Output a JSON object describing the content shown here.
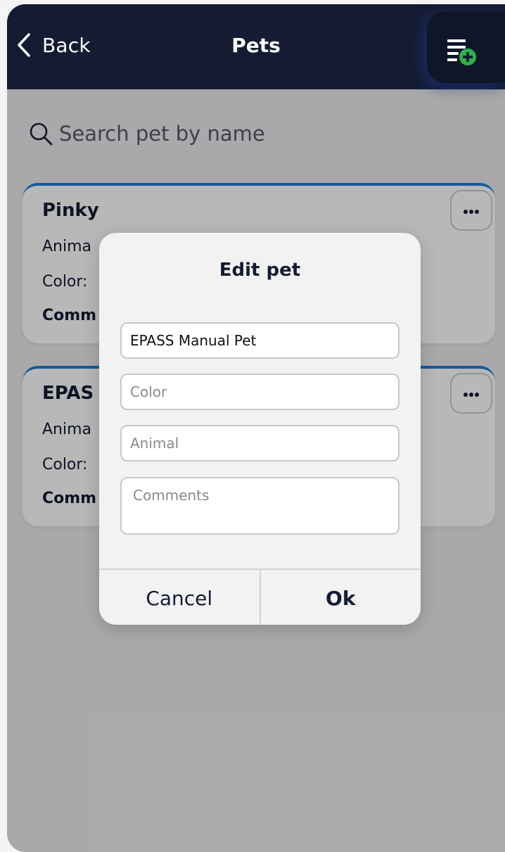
{
  "header": {
    "back_label": "Back",
    "title": "Pets",
    "add_icon": "list-add-icon"
  },
  "search": {
    "placeholder": "Search pet by name",
    "icon": "search-icon"
  },
  "cards": [
    {
      "name": "Pinky",
      "animal_label": "Anima",
      "color_label": "Color:",
      "comments_label": "Comm"
    },
    {
      "name": "EPAS",
      "animal_label": "Anima",
      "color_label": "Color:",
      "comments_label": "Comm"
    }
  ],
  "dialog": {
    "title": "Edit pet",
    "name_value": "EPASS Manual Pet",
    "color_placeholder": "Color",
    "animal_placeholder": "Animal",
    "comments_placeholder": "Comments",
    "cancel_label": "Cancel",
    "ok_label": "Ok"
  },
  "colors": {
    "header_bg": "#141b33",
    "accent": "#1d7fd6",
    "add_badge": "#2bb24c"
  }
}
